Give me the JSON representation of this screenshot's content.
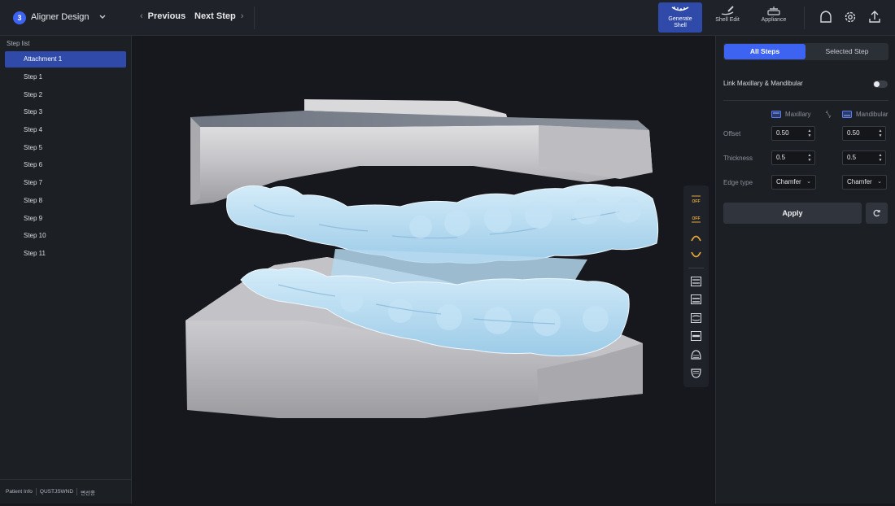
{
  "header": {
    "step_number": "3",
    "title": "Aligner Design",
    "prev_label": "Previous",
    "next_label": "Next Step",
    "tools": [
      {
        "label": "Generate Shell",
        "active": true
      },
      {
        "label": "Shell Edit",
        "active": false
      },
      {
        "label": "Appliance",
        "active": false
      }
    ]
  },
  "step_list": {
    "title": "Step list",
    "items": [
      "Attachment 1",
      "Step 1",
      "Step 2",
      "Step 3",
      "Step 4",
      "Step 5",
      "Step 6",
      "Step 7",
      "Step 8",
      "Step 9",
      "Step 10",
      "Step 11"
    ],
    "selected": "Attachment 1"
  },
  "footer": {
    "patient_info": "Patient Info",
    "patient_id": "QUSTJSWND",
    "patient_name": "변선종"
  },
  "view_toolbar": {
    "icons": [
      "off-icon",
      "off-icon",
      "upper-jaw-icon",
      "lower-jaw-icon",
      "view-front-icon",
      "view-back-icon",
      "view-left-icon",
      "view-right-icon",
      "view-top-icon",
      "view-bottom-icon"
    ],
    "off_label": "OFF"
  },
  "right_panel": {
    "tabs": [
      "All Steps",
      "Selected Step"
    ],
    "active_tab": "All Steps",
    "link_label": "Link Maxillary & Mandibular",
    "link_enabled": false,
    "col_maxillary": "Maxillary",
    "col_mandibular": "Mandibular",
    "offset_label": "Offset",
    "offset_max": "0.50",
    "offset_man": "0.50",
    "thickness_label": "Thickness",
    "thickness_max": "0.5",
    "thickness_man": "0.5",
    "edge_label": "Edge type",
    "edge_max": "Chamfer",
    "edge_man": "Chamfer",
    "apply_label": "Apply"
  },
  "colors": {
    "accent": "#3d63f2",
    "active_tool": "#2f4aa8",
    "model_gray": "#c9c9cc",
    "aligner_blue": "#a9d4ee"
  }
}
